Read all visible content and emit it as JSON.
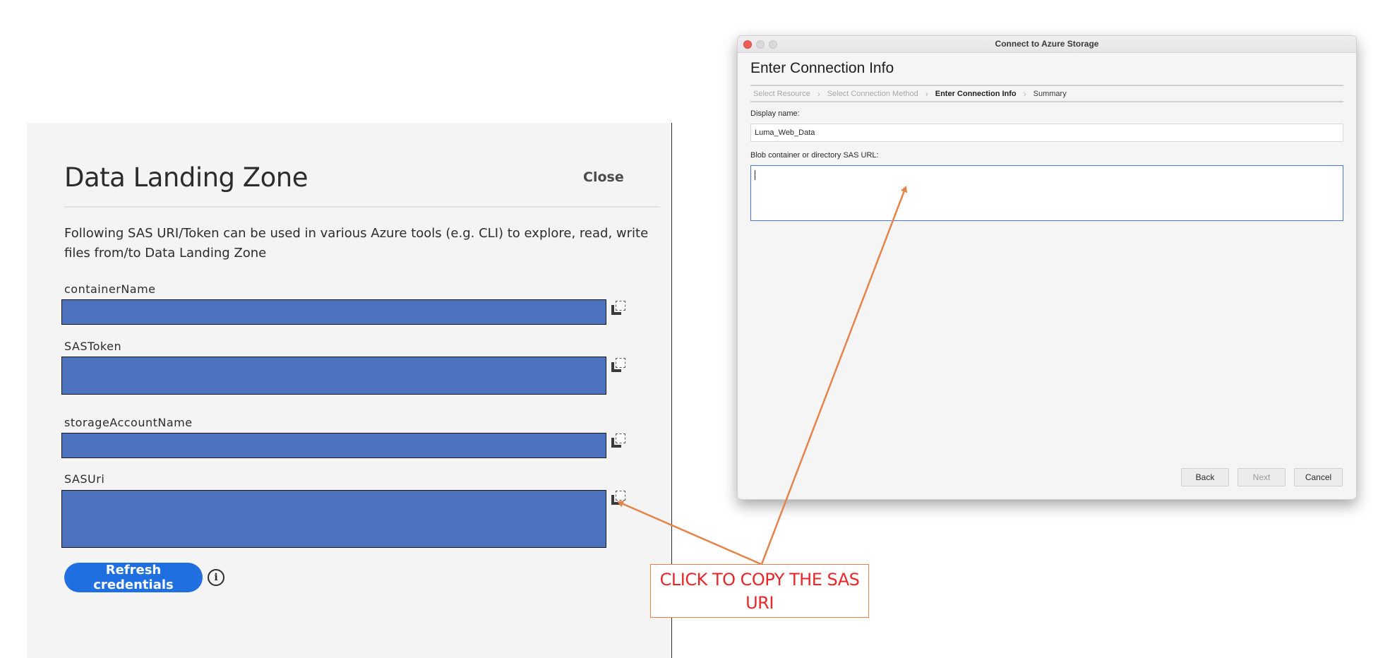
{
  "dlz": {
    "title": "Data Landing Zone",
    "close_label": "Close",
    "description": "Following SAS URI/Token can be used in various Azure tools (e.g. CLI) to explore, read, write files from/to Data Landing Zone",
    "fields": [
      {
        "label": "containerName"
      },
      {
        "label": "SASToken"
      },
      {
        "label": "storageAccountName"
      },
      {
        "label": "SASUri"
      }
    ],
    "refresh_label": "Refresh credentials",
    "info_glyph": "i",
    "field_color": "#4d73bf",
    "button_color": "#1f6fe1"
  },
  "azure": {
    "window_title": "Connect to Azure Storage",
    "heading": "Enter Connection Info",
    "breadcrumbs": [
      {
        "label": "Select Resource",
        "state": "done"
      },
      {
        "label": "Select Connection Method",
        "state": "done"
      },
      {
        "label": "Enter Connection Info",
        "state": "active"
      },
      {
        "label": "Summary",
        "state": "pending"
      }
    ],
    "display_name_label": "Display name:",
    "display_name_value": "Luma_Web_Data",
    "sas_url_label": "Blob container or directory SAS URL:",
    "sas_url_value": "",
    "buttons": {
      "back": "Back",
      "next": "Next",
      "cancel": "Cancel"
    }
  },
  "annotation": {
    "text": "CLICK TO COPY THE SAS URI",
    "text_color": "#e8272a",
    "arrow_color": "#e5844a"
  }
}
